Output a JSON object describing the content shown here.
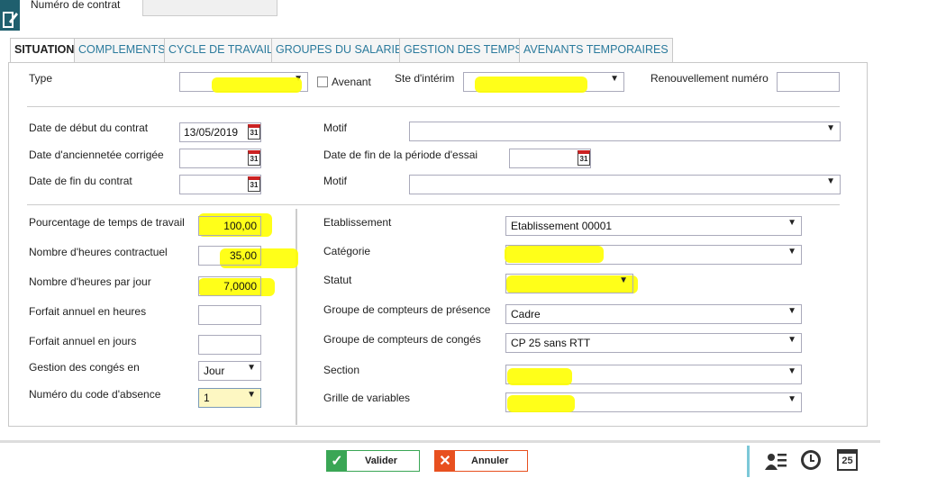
{
  "header": {
    "contract_label": "Numéro de contrat",
    "contract_value": ""
  },
  "tabs": [
    "SITUATION",
    "COMPLEMENTS",
    "CYCLE DE TRAVAIL",
    "GROUPES DU SALARIE",
    "GESTION DES TEMPS",
    "AVENANTS TEMPORAIRES"
  ],
  "row1": {
    "type_label": "Type",
    "type_value": "",
    "avenant_label": "Avenant",
    "ste_label": "Ste d'intérim",
    "ste_value": "",
    "renouv_label": "Renouvellement numéro",
    "renouv_value": ""
  },
  "dates": {
    "debut_label": "Date de début du contrat",
    "debut_value": "13/05/2019",
    "anc_label": "Date d'anciennetée corrigée",
    "anc_value": "",
    "fin_label": "Date de fin du contrat",
    "fin_value": "",
    "motif1_label": "Motif",
    "motif1_value": "",
    "essai_label": "Date de fin de la période d'essai",
    "essai_value": "",
    "motif2_label": "Motif",
    "motif2_value": "",
    "cal_text": "31"
  },
  "left": {
    "pct_label": "Pourcentage de temps de travail",
    "pct_value": "100,00",
    "hcontr_label": "Nombre d'heures contractuel",
    "hcontr_value": "35,00",
    "hjour_label": "Nombre d'heures par jour",
    "hjour_value": "7,0000",
    "fheures_label": "Forfait annuel en heures",
    "fheures_value": "",
    "fjours_label": "Forfait annuel en jours",
    "fjours_value": "",
    "conges_label": "Gestion des congés en",
    "conges_value": "Jour",
    "absence_label": "Numéro du code d'absence",
    "absence_value": "1"
  },
  "right": {
    "etab_label": "Etablissement",
    "etab_value": "Etablissement 00001",
    "cat_label": "Catégorie",
    "cat_value": "",
    "statut_label": "Statut",
    "statut_value": "",
    "gpres_label": "Groupe de compteurs de présence",
    "gpres_value": "Cadre",
    "gconges_label": "Groupe de compteurs de congés",
    "gconges_value": "CP 25 sans RTT",
    "section_label": "Section",
    "section_value": "",
    "grille_label": "Grille de variables",
    "grille_value": ""
  },
  "footer": {
    "valider": "Valider",
    "annuler": "Annuler",
    "calendar_day": "25"
  },
  "colors": {
    "accent": "#2a7a9c",
    "highlight": "#ffff00",
    "valider": "#3aa655",
    "annuler": "#e8501f"
  },
  "arrow": "▼"
}
